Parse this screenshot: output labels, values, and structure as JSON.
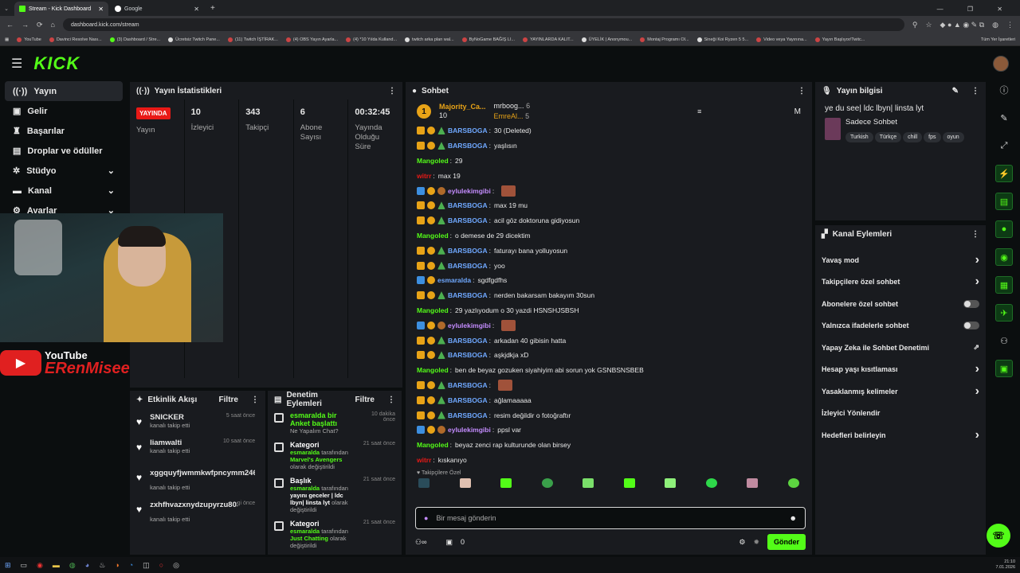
{
  "browser": {
    "tabs": [
      {
        "label": "Stream - Kick Dashboard"
      },
      {
        "label": "Google"
      }
    ],
    "url": "dashboard.kick.com/stream",
    "bookmarks": [
      "YouTube",
      "Davinci Resolve Nası...",
      "(3) Dashboard / Stre...",
      "Ücretsiz Twitch Pane...",
      "(11) Twitch İŞTİRAK...",
      "(4) OBS Yayın Ayarla...",
      "(4) *10 Yılda Kulland...",
      "twitch arka plan wal...",
      "ByNoGame BAĞIŞ LI...",
      "YAYINLARDA KALIT...",
      "ÜYELİK | Anonymou...",
      "Montaj Programı Ol...",
      "Sineği Koi Ryzen 5 5...",
      "Video veya Yayınına...",
      "Yayın Başlıyor/Twitc..."
    ],
    "bookmarks_right": "Tüm Yer İşaretleri"
  },
  "header": {
    "logo": "KICK"
  },
  "sidebar": {
    "items": [
      {
        "label": "Yayın"
      },
      {
        "label": "Gelir"
      },
      {
        "label": "Başarılar"
      },
      {
        "label": "Droplar ve ödüller"
      },
      {
        "label": "Stüdyo"
      },
      {
        "label": "Kanal"
      },
      {
        "label": "Ayarlar"
      }
    ]
  },
  "stats": {
    "title": "Yayın İstatistikleri",
    "live_badge": "YAYINDA",
    "cols": [
      {
        "value": "",
        "label": "Yayın"
      },
      {
        "value": "10",
        "label": "İzleyici"
      },
      {
        "value": "343",
        "label": "Takipçi"
      },
      {
        "value": "6",
        "label": "Abone Sayısı"
      },
      {
        "value": "00:32:45",
        "label": "Yayında Olduğu Süre"
      }
    ]
  },
  "overlay": {
    "youtube_label": "YouTube",
    "channel": "ERenMisee"
  },
  "activity": {
    "title": "Etkinlik Akışı",
    "filter": "Filtre",
    "items": [
      {
        "name": "SNICKER",
        "desc": "kanalı takip etti",
        "time": "5 saat önce"
      },
      {
        "name": "liamwalti",
        "desc": "kanalı takip etti",
        "time": "10 saat önce"
      },
      {
        "name": "xggquyfjwmmkwfpncymm246",
        "desc": "kanalı takip etti",
        "time": ""
      },
      {
        "name": "zxhfhvazxnydzupyrzu8033",
        "desc": "kanalı takip etti",
        "time": "gi önce"
      }
    ]
  },
  "moderation": {
    "title": "Denetim Eylemleri",
    "filter": "Filtre",
    "items": [
      {
        "title": "esmaralda bir Anket başlattı",
        "sub": "Ne Yapalım Chat?",
        "time": "10 dakika önce"
      },
      {
        "title": "Kategori",
        "by": "esmaralda",
        "mid": "tarafından",
        "value": "Marvel's Avengers",
        "end": "olarak değiştirildi",
        "time": "21 saat önce"
      },
      {
        "title": "Başlık",
        "by": "esmaralda",
        "mid": "tarafından",
        "value": "yayını geceler | ldc lbyn| linsta lyt",
        "end": "olarak değiştirildi",
        "time": "21 saat önce"
      },
      {
        "title": "Kategori",
        "by": "esmaralda",
        "mid": "tarafından",
        "value": "Just Chatting",
        "end": "olarak değiştirildi",
        "time": "21 saat önce"
      }
    ]
  },
  "chat": {
    "title": "Sohbet",
    "pinned": {
      "user": "Majority_Ca...",
      "rank": "1",
      "count": "10",
      "u2": "mrboog...",
      "c2": "6",
      "u3": "EmreAl...",
      "c3": "5",
      "letter": "M"
    },
    "messages": [
      {
        "user": "BARSBOGA",
        "text": "30 (Deleted)",
        "style": "blue",
        "badges": [
          "crown",
          "one",
          "tree"
        ]
      },
      {
        "user": "BARSBOGA",
        "text": "yaşlısın",
        "style": "blue",
        "badges": [
          "crown",
          "one",
          "tree"
        ]
      },
      {
        "user": "Mangoled",
        "text": "29",
        "style": "green",
        "badges": []
      },
      {
        "user": "witrr",
        "text": "max 19",
        "style": "red",
        "badges": []
      },
      {
        "user": "eylulekimgibi",
        "text": "",
        "style": "purple",
        "badges": [
          "blue",
          "one",
          "pie"
        ],
        "emote": true
      },
      {
        "user": "BARSBOGA",
        "text": "max 19 mu",
        "style": "blue",
        "badges": [
          "crown",
          "one",
          "tree"
        ]
      },
      {
        "user": "BARSBOGA",
        "text": "acil göz doktoruna gidiyosun",
        "style": "blue",
        "badges": [
          "crown",
          "one",
          "tree"
        ]
      },
      {
        "user": "Mangoled",
        "text": "o demese de 29 dicektim",
        "style": "green",
        "badges": []
      },
      {
        "user": "BARSBOGA",
        "text": "faturayı bana yolluyosun",
        "style": "blue",
        "badges": [
          "crown",
          "one",
          "tree"
        ]
      },
      {
        "user": "BARSBOGA",
        "text": "yoo",
        "style": "blue",
        "badges": [
          "crown",
          "one",
          "tree"
        ]
      },
      {
        "user": "esmaralda",
        "text": "sgdfgdfhs",
        "style": "blue",
        "badges": [
          "blue",
          "one"
        ]
      },
      {
        "user": "BARSBOGA",
        "text": "nerden bakarsam bakayım 30sun",
        "style": "blue",
        "badges": [
          "crown",
          "one",
          "tree"
        ]
      },
      {
        "user": "Mangoled",
        "text": "29 yazlıyodum o 30 yazdi HSNSHJSBSH",
        "style": "green",
        "badges": []
      },
      {
        "user": "eylulekimgibi",
        "text": "",
        "style": "purple",
        "badges": [
          "blue",
          "one",
          "pie"
        ],
        "emote": true
      },
      {
        "user": "BARSBOGA",
        "text": "arkadan 40 gibisin hatta",
        "style": "blue",
        "badges": [
          "crown",
          "one",
          "tree"
        ]
      },
      {
        "user": "BARSBOGA",
        "text": "aşkjdkja xD",
        "style": "blue",
        "badges": [
          "crown",
          "one",
          "tree"
        ]
      },
      {
        "user": "Mangoled",
        "text": "ben de beyaz gozuken siyahiyim abi sorun yok GSNBSNSBEB",
        "style": "green",
        "badges": []
      },
      {
        "user": "BARSBOGA",
        "text": "",
        "style": "blue",
        "badges": [
          "crown",
          "one",
          "tree"
        ],
        "emote": true
      },
      {
        "user": "BARSBOGA",
        "text": "ağlamaaaaa",
        "style": "blue",
        "badges": [
          "crown",
          "one",
          "tree"
        ]
      },
      {
        "user": "BARSBOGA",
        "text": "resim değildir o fotoğraftır",
        "style": "blue",
        "badges": [
          "crown",
          "one",
          "tree"
        ]
      },
      {
        "user": "eylulekimgibi",
        "text": "ppsl var",
        "style": "purple",
        "badges": [
          "blue",
          "one",
          "pie"
        ]
      },
      {
        "user": "Mangoled",
        "text": "beyaz zenci rap kulturunde olan birsey",
        "style": "green",
        "badges": []
      },
      {
        "user": "witrr",
        "text": "kıskanıyo",
        "style": "red",
        "badges": []
      }
    ],
    "followers_only": "Takipçilere Özel",
    "input_placeholder": "Bir mesaj gönderin",
    "footer_count": "0",
    "send": "Gönder"
  },
  "info": {
    "title": "Yayın bilgisi",
    "stream_title": "ye du see| ldc lbyn| linsta lyt",
    "category": "Sadece Sohbet",
    "tags": [
      "Turkish",
      "Türkçe",
      "chill",
      "fps",
      "oyun"
    ]
  },
  "channel_actions": {
    "title": "Kanal Eylemleri",
    "items": [
      {
        "label": "Yavaş mod",
        "control": "arrow"
      },
      {
        "label": "Takipçilere özel sohbet",
        "control": "arrow"
      },
      {
        "label": "Abonelere özel sohbet",
        "control": "toggle"
      },
      {
        "label": "Yalnızca ifadelerle sohbet",
        "control": "toggle"
      },
      {
        "label": "Yapay Zeka ile Sohbet Denetimi",
        "control": "external"
      },
      {
        "label": "Hesap yaşı kısıtlaması",
        "control": "arrow"
      },
      {
        "label": "Yasaklanmış kelimeler",
        "control": "arrow"
      },
      {
        "label": "İzleyici Yönlendir",
        "control": "none"
      },
      {
        "label": "Hedefleri belirleyin",
        "control": "arrow"
      }
    ]
  },
  "taskbar": {
    "time": "21:10",
    "date": "7.01.2026"
  },
  "colors": {
    "accent": "#53fc18",
    "live": "#e91916",
    "panel": "#191b1f",
    "bg": "#0b0e0f"
  }
}
